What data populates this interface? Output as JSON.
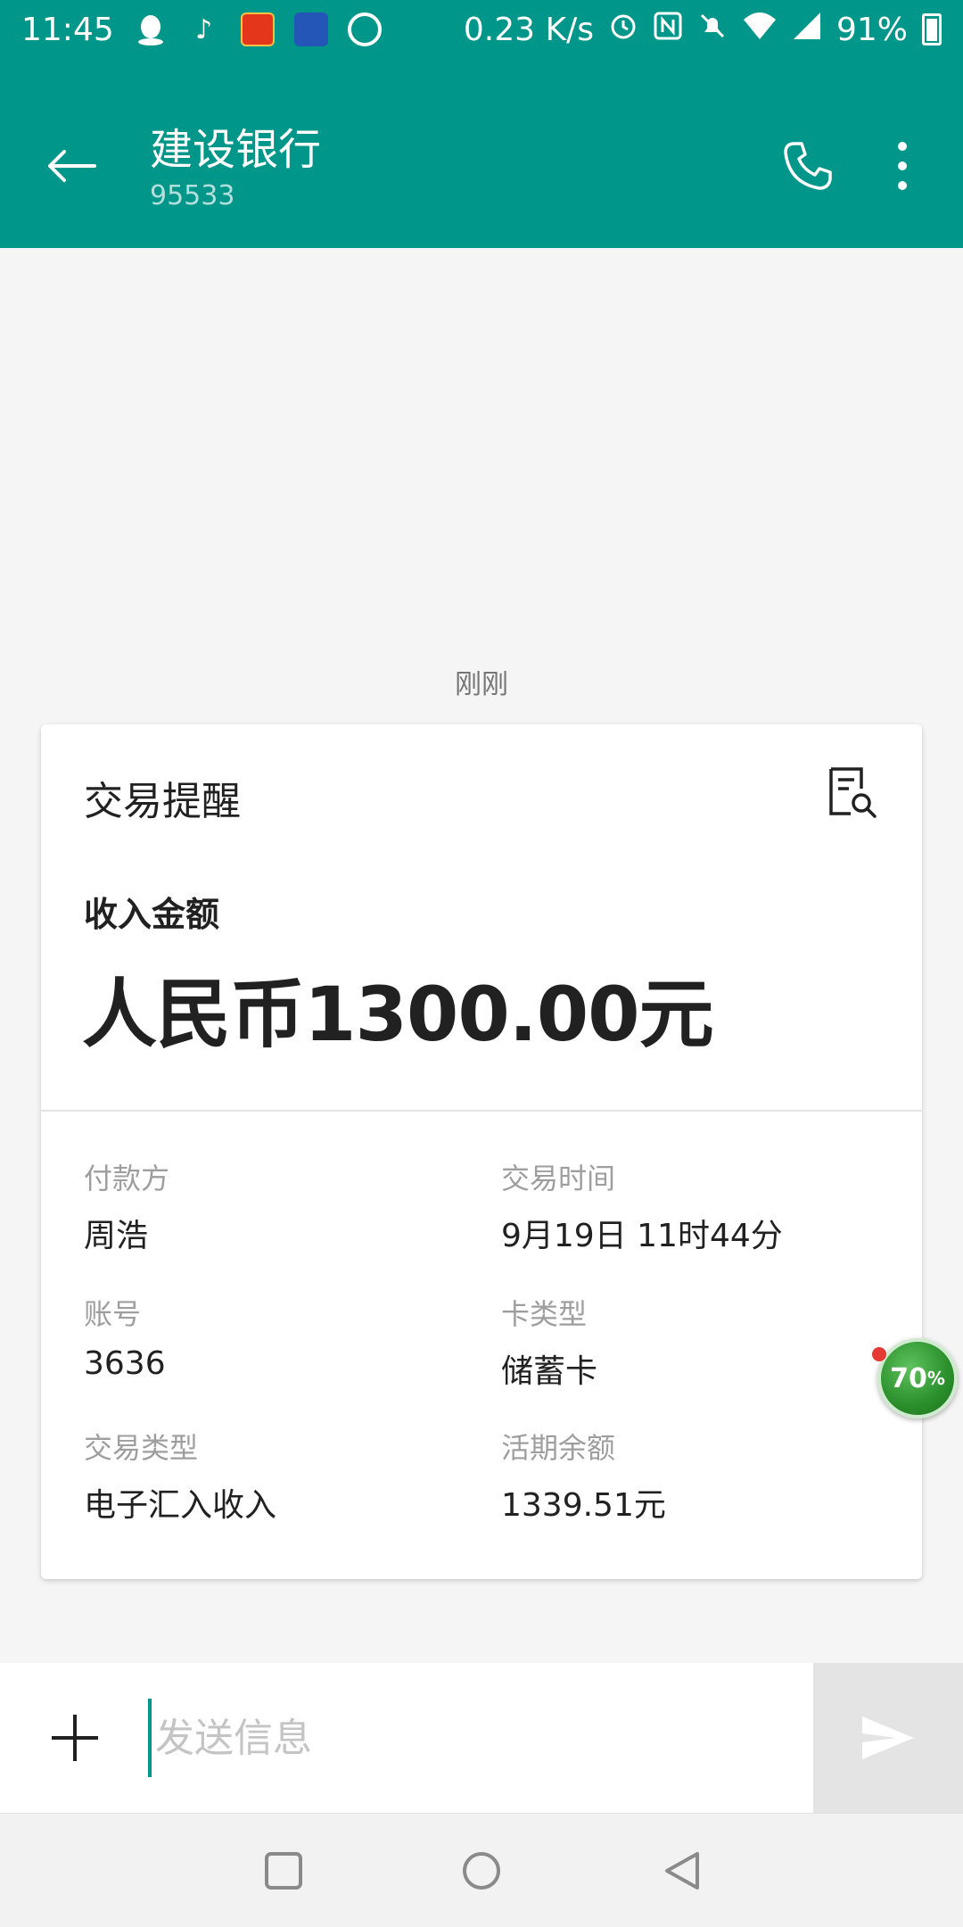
{
  "status_bar": {
    "time": "11:45",
    "network_speed": "0.23 K/s",
    "battery": "91%",
    "icons": [
      "qq-icon",
      "tiktok-icon",
      "app-icon",
      "app-icon",
      "sync-icon",
      "alarm-icon",
      "nfc-icon",
      "mute-icon",
      "wifi-icon",
      "signal-icon",
      "battery-icon"
    ]
  },
  "header": {
    "title": "建设银行",
    "subtitle": "95533"
  },
  "conversation": {
    "time_label": "刚刚",
    "card": {
      "title": "交易提醒",
      "amount_label": "收入金额",
      "amount_value": "人民币1300.00元",
      "fields": [
        {
          "label": "付款方",
          "value": "周浩"
        },
        {
          "label": "交易时间",
          "value": "9月19日 11时44分"
        },
        {
          "label": "账号",
          "value": "3636"
        },
        {
          "label": "卡类型",
          "value": "储蓄卡"
        },
        {
          "label": "交易类型",
          "value": "电子汇入收入"
        },
        {
          "label": "活期余额",
          "value": "1339.51元"
        }
      ]
    }
  },
  "floating_widget": {
    "value": "70",
    "unit": "%"
  },
  "compose": {
    "placeholder": "发送信息"
  },
  "colors": {
    "primary": "#00968a",
    "background": "#f5f5f5",
    "card": "#ffffff"
  }
}
